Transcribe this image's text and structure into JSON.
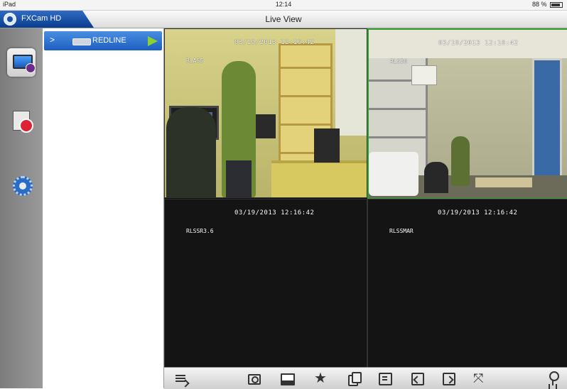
{
  "status_bar": {
    "device": "iPad",
    "time": "12:14",
    "battery": "88 %"
  },
  "title_bar": {
    "app_name": "FXCam HD",
    "page_title": "Live View"
  },
  "sidebar": {
    "items": [
      {
        "name": "live-view",
        "icon": "monitor-icon",
        "active": true
      },
      {
        "name": "playback",
        "icon": "film-reel-icon",
        "active": false
      },
      {
        "name": "settings",
        "icon": "gear-icon",
        "active": false
      }
    ]
  },
  "device_list": {
    "devices": [
      {
        "chevron": ">",
        "label": "REDLINE",
        "icon": "dvr-icon",
        "play_icon": "play-icon"
      }
    ]
  },
  "cameras": [
    {
      "channel": "RLAS8",
      "timestamp": "03/19/2013 12:16:42",
      "selected": false,
      "has_video": true
    },
    {
      "channel": "RLS50",
      "timestamp": "03/19/2013 12:16:42",
      "selected": true,
      "has_video": true
    },
    {
      "channel": "RLSSR3.6",
      "timestamp": "03/19/2013 12:16:42",
      "selected": false,
      "has_video": false
    },
    {
      "channel": "RLSSMAR",
      "timestamp": "03/19/2013 12:16:42",
      "selected": false,
      "has_video": false
    }
  ],
  "toolbar": {
    "buttons": [
      {
        "name": "channel-list",
        "icon": "list-icon"
      },
      {
        "name": "snapshot",
        "icon": "camera-icon"
      },
      {
        "name": "gallery",
        "icon": "gallery-icon"
      },
      {
        "name": "favorite",
        "icon": "star-icon"
      },
      {
        "name": "copy-view",
        "icon": "copy-icon"
      },
      {
        "name": "preset",
        "icon": "preset-icon"
      },
      {
        "name": "zoom-in",
        "icon": "zoom-in-icon"
      },
      {
        "name": "zoom-out",
        "icon": "zoom-out-icon"
      },
      {
        "name": "fullscreen",
        "icon": "fullscreen-icon"
      },
      {
        "name": "ptz-control",
        "icon": "ptz-icon"
      }
    ],
    "star_glyph": "★"
  },
  "colors": {
    "title_tab_blue": "#0a3d8c",
    "selected_border_green": "#2fa52f",
    "device_row_blue": "#1d5ec2"
  }
}
